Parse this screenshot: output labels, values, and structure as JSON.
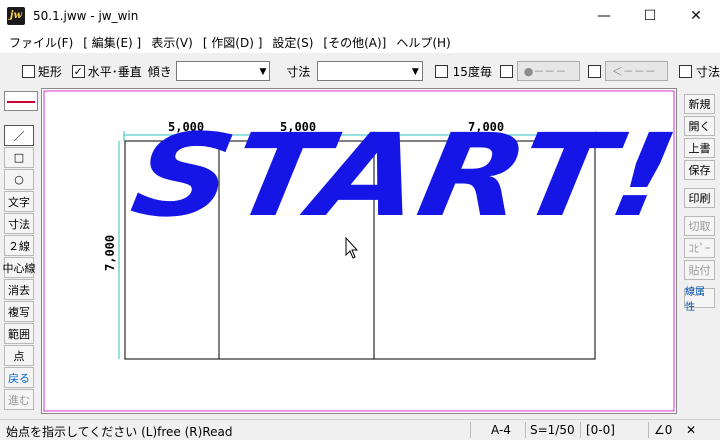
{
  "window": {
    "title": "50.1.jww - jw_win",
    "icon_text": "jw",
    "min_glyph": "—",
    "max_glyph": "☐",
    "close_glyph": "✕"
  },
  "menu": [
    "ファイル(F)",
    "[ 編集(E) ]",
    "表示(V)",
    "[ 作図(D) ]",
    "設定(S)",
    "[その他(A)]",
    "ヘルプ(H)"
  ],
  "toolbar": {
    "rect_label": "矩形",
    "rect_checked": false,
    "hv_label": "水平･垂直",
    "hv_checked": true,
    "hv_check_glyph": "✓",
    "tilt_label": "傾き",
    "tilt_value": "",
    "dim_label": "寸法",
    "dim_value": "",
    "deg15_label": "15度毎",
    "btn1_label": "●－－－",
    "btn2_label": "＜－－－",
    "dim2_label": "寸法",
    "combo_arrow": "▼"
  },
  "left_tools": [
    {
      "label": "／",
      "name": "line",
      "active": true,
      "color": "normal"
    },
    {
      "label": "□",
      "name": "rectangle",
      "active": false,
      "color": "normal"
    },
    {
      "label": "○",
      "name": "circle",
      "active": false,
      "color": "normal"
    },
    {
      "label": "文字",
      "name": "text",
      "active": false,
      "color": "normal"
    },
    {
      "label": "寸法",
      "name": "dimension",
      "active": false,
      "color": "normal"
    },
    {
      "label": "２線",
      "name": "double-line",
      "active": false,
      "color": "normal"
    },
    {
      "label": "中心線",
      "name": "center-line",
      "active": false,
      "color": "normal"
    },
    {
      "label": "消去",
      "name": "erase",
      "active": false,
      "color": "normal"
    },
    {
      "label": "複写",
      "name": "copy",
      "active": false,
      "color": "normal"
    },
    {
      "label": "範囲",
      "name": "range",
      "active": false,
      "color": "normal"
    },
    {
      "label": "点",
      "name": "point",
      "active": false,
      "color": "normal"
    },
    {
      "label": "戻る",
      "name": "undo",
      "active": false,
      "color": "blue"
    },
    {
      "label": "進む",
      "name": "redo",
      "active": false,
      "color": "disabled"
    }
  ],
  "right_tools": [
    {
      "label": "新規",
      "name": "new",
      "state": "normal",
      "gap_before": false
    },
    {
      "label": "開く",
      "name": "open",
      "state": "normal",
      "gap_before": false
    },
    {
      "label": "上書",
      "name": "overwrite",
      "state": "normal",
      "gap_before": false
    },
    {
      "label": "保存",
      "name": "save",
      "state": "normal",
      "gap_before": false
    },
    {
      "label": "印刷",
      "name": "print",
      "state": "normal",
      "gap_before": true
    },
    {
      "label": "切取",
      "name": "cut",
      "state": "disabled",
      "gap_before": true
    },
    {
      "label": "ｺﾋﾟｰ",
      "name": "copy",
      "state": "disabled",
      "gap_before": false
    },
    {
      "label": "貼付",
      "name": "paste",
      "state": "disabled",
      "gap_before": false
    },
    {
      "label": "線属性",
      "name": "line-attribute",
      "state": "blue",
      "gap_before": true
    }
  ],
  "drawing": {
    "dim_labels": [
      "5,000",
      "5,000",
      "7,000"
    ],
    "overlay_text": "START!",
    "overlay_color": "#1515e6"
  },
  "status": {
    "message": "始点を指示してください (L)free (R)Read",
    "paper": "A-4",
    "scale": "S=1/50",
    "layer": "[0-0]",
    "angle": "∠0",
    "close_glyph": "✕"
  }
}
